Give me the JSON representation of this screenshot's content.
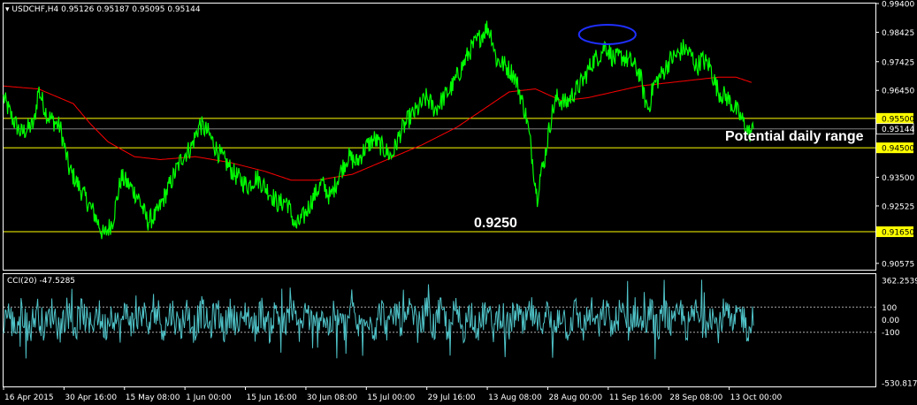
{
  "colors": {
    "background": "#000000",
    "price": "#00ff00",
    "ma": "#ff0000",
    "level": "#ffff00",
    "cci": "#4fc3c8",
    "axis_text": "#ffffff",
    "frame": "#ffffff",
    "ellipse": "#1f2fff",
    "current_price_line": "#808080"
  },
  "main_pane": {
    "header_icon": "dropdown-triangle-icon",
    "symbol": "USDCHF,H4",
    "ohlc": "0.95126 0.95187 0.95095 0.95144"
  },
  "cci_pane": {
    "label": "CCI(20) -47.5285"
  },
  "annotations": {
    "potential_range": "Potential daily range",
    "low_level": "0.9250"
  },
  "chart_data": [
    {
      "type": "line",
      "pane": "price",
      "ylim": [
        0.9036,
        0.994
      ],
      "yticks": [
        "0.99400",
        "0.98425",
        "0.97425",
        "0.96450",
        "0.95500",
        "0.95144",
        "0.94500",
        "0.93500",
        "0.92525",
        "0.91650",
        "0.90575"
      ],
      "ytick_values": [
        0.994,
        0.98425,
        0.97425,
        0.9645,
        0.955,
        0.95144,
        0.945,
        0.935,
        0.92525,
        0.9165,
        0.90575
      ],
      "xticks": [
        "16 Apr 2015",
        "30 Apr 16:00",
        "15 May 08:00",
        "1 Jun 00:00",
        "15 Jun 16:00",
        "30 Jun 08:00",
        "15 Jul 00:00",
        "29 Jul 16:00",
        "13 Aug 08:00",
        "28 Aug 00:00",
        "11 Sep 16:00",
        "28 Sep 08:00",
        "13 Oct 00:00"
      ],
      "horizontal_levels": [
        0.955,
        0.945,
        0.9165
      ],
      "current_price": 0.95144,
      "price_anchors": [
        [
          0.0,
          0.962
        ],
        [
          0.01,
          0.955
        ],
        [
          0.02,
          0.95
        ],
        [
          0.035,
          0.953
        ],
        [
          0.04,
          0.965
        ],
        [
          0.05,
          0.956
        ],
        [
          0.065,
          0.952
        ],
        [
          0.075,
          0.938
        ],
        [
          0.09,
          0.93
        ],
        [
          0.105,
          0.922
        ],
        [
          0.115,
          0.915
        ],
        [
          0.125,
          0.92
        ],
        [
          0.135,
          0.935
        ],
        [
          0.145,
          0.932
        ],
        [
          0.155,
          0.928
        ],
        [
          0.165,
          0.92
        ],
        [
          0.175,
          0.922
        ],
        [
          0.19,
          0.932
        ],
        [
          0.205,
          0.942
        ],
        [
          0.215,
          0.945
        ],
        [
          0.225,
          0.953
        ],
        [
          0.235,
          0.95
        ],
        [
          0.245,
          0.944
        ],
        [
          0.255,
          0.94
        ],
        [
          0.265,
          0.936
        ],
        [
          0.28,
          0.932
        ],
        [
          0.29,
          0.935
        ],
        [
          0.305,
          0.93
        ],
        [
          0.315,
          0.926
        ],
        [
          0.325,
          0.927
        ],
        [
          0.335,
          0.918
        ],
        [
          0.345,
          0.922
        ],
        [
          0.355,
          0.928
        ],
        [
          0.365,
          0.933
        ],
        [
          0.375,
          0.928
        ],
        [
          0.385,
          0.936
        ],
        [
          0.395,
          0.942
        ],
        [
          0.405,
          0.94
        ],
        [
          0.415,
          0.945
        ],
        [
          0.425,
          0.948
        ],
        [
          0.435,
          0.945
        ],
        [
          0.445,
          0.942
        ],
        [
          0.455,
          0.95
        ],
        [
          0.465,
          0.955
        ],
        [
          0.475,
          0.958
        ],
        [
          0.485,
          0.962
        ],
        [
          0.495,
          0.958
        ],
        [
          0.505,
          0.962
        ],
        [
          0.515,
          0.966
        ],
        [
          0.525,
          0.972
        ],
        [
          0.535,
          0.978
        ],
        [
          0.545,
          0.982
        ],
        [
          0.555,
          0.986
        ],
        [
          0.56,
          0.983
        ],
        [
          0.565,
          0.975
        ],
        [
          0.575,
          0.973
        ],
        [
          0.585,
          0.97
        ],
        [
          0.59,
          0.966
        ],
        [
          0.6,
          0.955
        ],
        [
          0.605,
          0.945
        ],
        [
          0.612,
          0.928
        ],
        [
          0.615,
          0.935
        ],
        [
          0.62,
          0.94
        ],
        [
          0.625,
          0.95
        ],
        [
          0.63,
          0.958
        ],
        [
          0.635,
          0.962
        ],
        [
          0.645,
          0.96
        ],
        [
          0.655,
          0.964
        ],
        [
          0.665,
          0.968
        ],
        [
          0.675,
          0.974
        ],
        [
          0.685,
          0.977
        ],
        [
          0.69,
          0.98
        ],
        [
          0.7,
          0.975
        ],
        [
          0.71,
          0.976
        ],
        [
          0.72,
          0.974
        ],
        [
          0.73,
          0.97
        ],
        [
          0.735,
          0.962
        ],
        [
          0.74,
          0.958
        ],
        [
          0.745,
          0.966
        ],
        [
          0.755,
          0.97
        ],
        [
          0.765,
          0.975
        ],
        [
          0.775,
          0.977
        ],
        [
          0.78,
          0.979
        ],
        [
          0.79,
          0.976
        ],
        [
          0.795,
          0.972
        ],
        [
          0.8,
          0.975
        ],
        [
          0.81,
          0.973
        ],
        [
          0.815,
          0.968
        ],
        [
          0.82,
          0.964
        ],
        [
          0.83,
          0.962
        ],
        [
          0.84,
          0.958
        ],
        [
          0.85,
          0.953
        ],
        [
          0.855,
          0.95
        ],
        [
          0.86,
          0.951
        ]
      ],
      "ma_anchors": [
        [
          0.0,
          0.966
        ],
        [
          0.04,
          0.965
        ],
        [
          0.08,
          0.96
        ],
        [
          0.1,
          0.953
        ],
        [
          0.12,
          0.947
        ],
        [
          0.15,
          0.942
        ],
        [
          0.18,
          0.941
        ],
        [
          0.22,
          0.942
        ],
        [
          0.26,
          0.94
        ],
        [
          0.3,
          0.937
        ],
        [
          0.33,
          0.934
        ],
        [
          0.36,
          0.934
        ],
        [
          0.4,
          0.936
        ],
        [
          0.44,
          0.941
        ],
        [
          0.48,
          0.946
        ],
        [
          0.52,
          0.952
        ],
        [
          0.55,
          0.958
        ],
        [
          0.58,
          0.964
        ],
        [
          0.61,
          0.965
        ],
        [
          0.64,
          0.961
        ],
        [
          0.67,
          0.962
        ],
        [
          0.7,
          0.964
        ],
        [
          0.73,
          0.966
        ],
        [
          0.76,
          0.967
        ],
        [
          0.79,
          0.968
        ],
        [
          0.82,
          0.969
        ],
        [
          0.84,
          0.969
        ],
        [
          0.86,
          0.967
        ]
      ],
      "ellipse_marker": {
        "x_frac": [
          0.66,
          0.725
        ],
        "y": 0.9835
      }
    },
    {
      "type": "line",
      "pane": "cci",
      "ylim": [
        -530.8174,
        362.2539
      ],
      "yticks": [
        "362.2539",
        "100",
        "0.00",
        "-100",
        "-530.8174"
      ],
      "ytick_values": [
        362.2539,
        100,
        0,
        -100,
        -530.8174
      ],
      "dotted_levels": [
        100,
        -100
      ],
      "current_value": -47.5285
    }
  ]
}
